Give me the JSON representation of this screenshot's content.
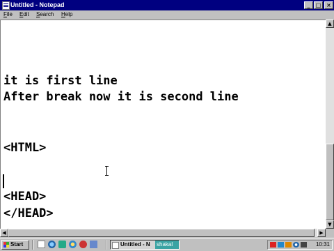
{
  "window": {
    "title": "Untitled - Notepad",
    "app_icon": "notepad-icon"
  },
  "titlebar_buttons": {
    "minimize": "_",
    "maximize": "□",
    "close": "×"
  },
  "menu": [
    {
      "label": "File",
      "accel": "F"
    },
    {
      "label": "Edit",
      "accel": "E"
    },
    {
      "label": "Search",
      "accel": "S"
    },
    {
      "label": "Help",
      "accel": "H"
    }
  ],
  "editor": {
    "lines": [
      "it is first line",
      "After break now it is second line",
      "<HTML>",
      "<HEAD>",
      "</HEAD>"
    ]
  },
  "scrollbar": {
    "up": "▲",
    "down": "▼",
    "left": "◀",
    "right": "▶"
  },
  "taskbar": {
    "start_label": "Start",
    "tasks": [
      {
        "label": "Untitled - N",
        "overlay": "shakal"
      }
    ],
    "clock": "10:31"
  },
  "colors": {
    "title_active": "#000080",
    "desktop_face": "#c0c0c0",
    "overlay": "#3aa3a3"
  }
}
